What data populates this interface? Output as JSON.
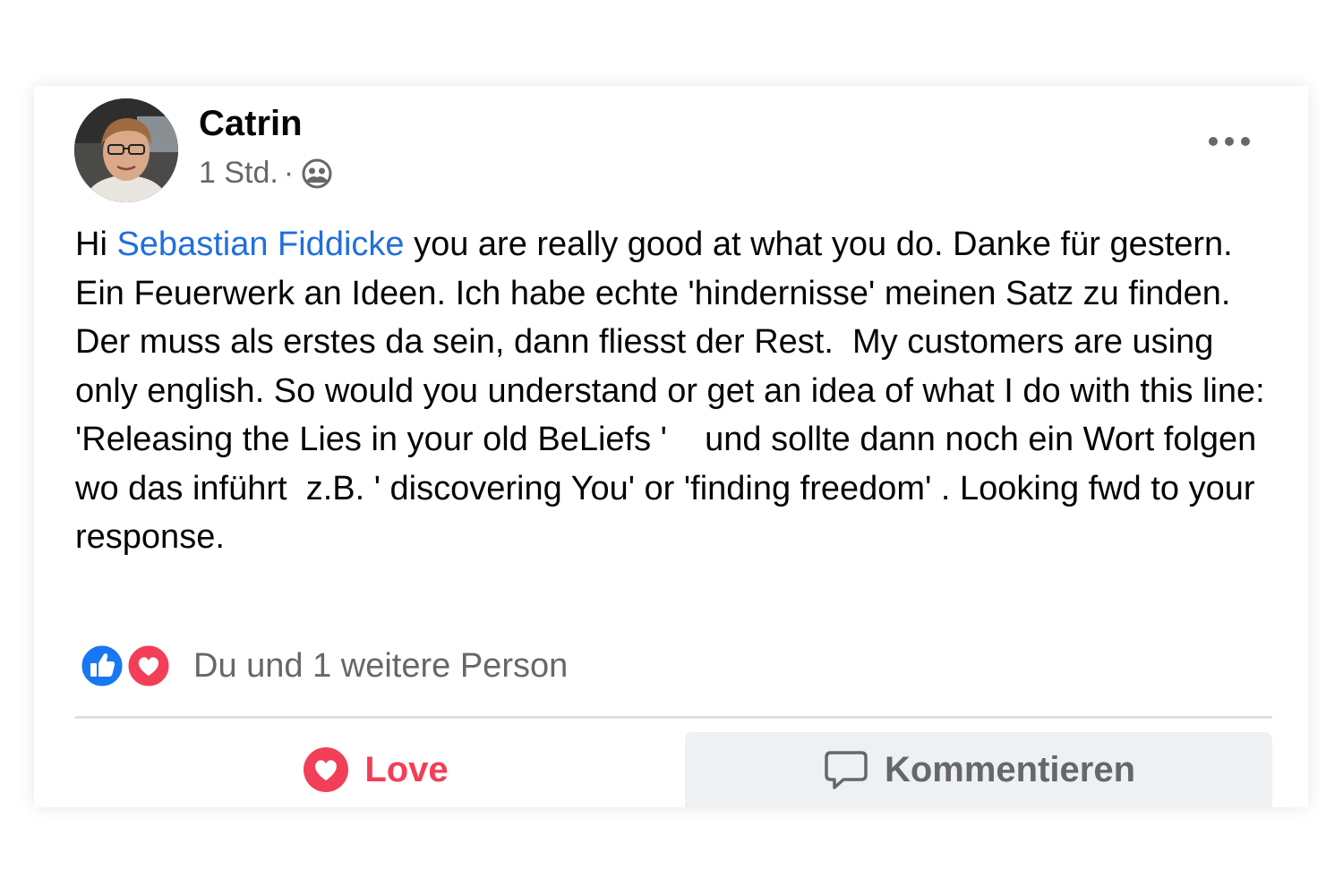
{
  "post": {
    "author": "Catrin",
    "timestamp": "1 Std.",
    "separator": "·",
    "audience_icon": "friends-icon",
    "more_icon": "ellipsis-icon",
    "text_prefix": "Hi ",
    "mention": "Sebastian Fiddicke",
    "text_body": " you are really good at what you do. Danke für gestern. Ein Feuerwerk an Ideen. Ich habe echte 'hindernisse' meinen Satz zu finden. Der muss als erstes da sein, dann fliesst der Rest.  My customers are using only english. So would you understand or get an idea of what I do with this line: 'Releasing the Lies in your old BeLiefs '    und sollte dann noch ein Wort folgen wo das inführt  z.B. ' discovering You' or 'finding freedom' . Looking fwd to your response."
  },
  "reactions": {
    "icons": [
      "like-icon",
      "love-icon"
    ],
    "summary": "Du und 1 weitere Person"
  },
  "actions": {
    "love_label": "Love",
    "comment_label": "Kommentieren"
  },
  "colors": {
    "mention": "#216fdb",
    "love": "#f33e58",
    "like": "#1877f2",
    "secondary_text": "#65676b"
  }
}
